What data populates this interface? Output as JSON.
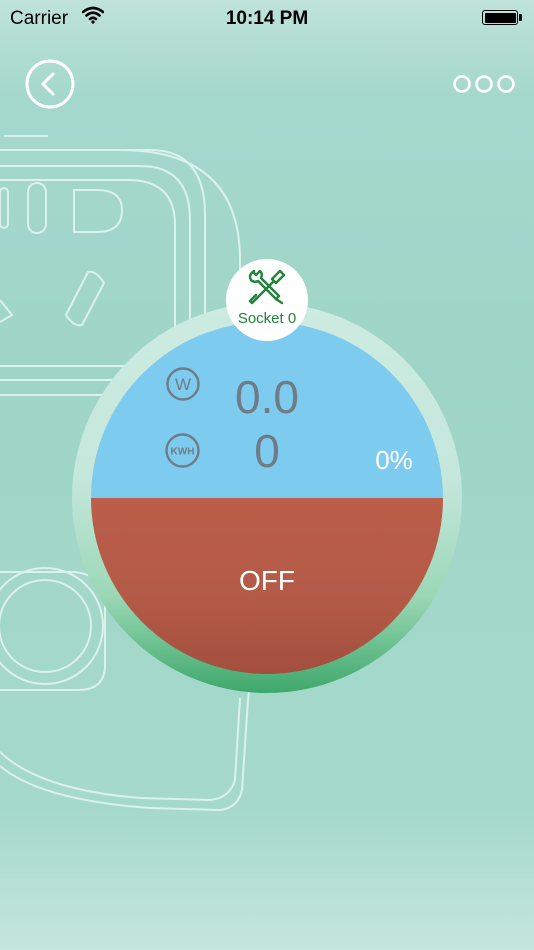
{
  "status_bar": {
    "carrier": "Carrier",
    "time": "10:14 PM",
    "wifi_icon": "wifi-icon",
    "battery_icon": "battery-icon"
  },
  "nav": {
    "back_icon": "chevron-left-icon",
    "more_icon": "more-icon"
  },
  "socket": {
    "name": "Socket 0",
    "settings_icon": "tools-icon",
    "power_value": "0.0",
    "power_unit_icon": "W",
    "energy_value": "0",
    "energy_unit_icon": "KWH",
    "percent": "0%",
    "switch_state": "OFF"
  },
  "colors": {
    "background": "#a0d5c7",
    "gauge_top": "#7ecbf0",
    "gauge_bottom": "#b45b48",
    "ring_accent": "#3ea86b",
    "socket_name": "#20833a"
  }
}
